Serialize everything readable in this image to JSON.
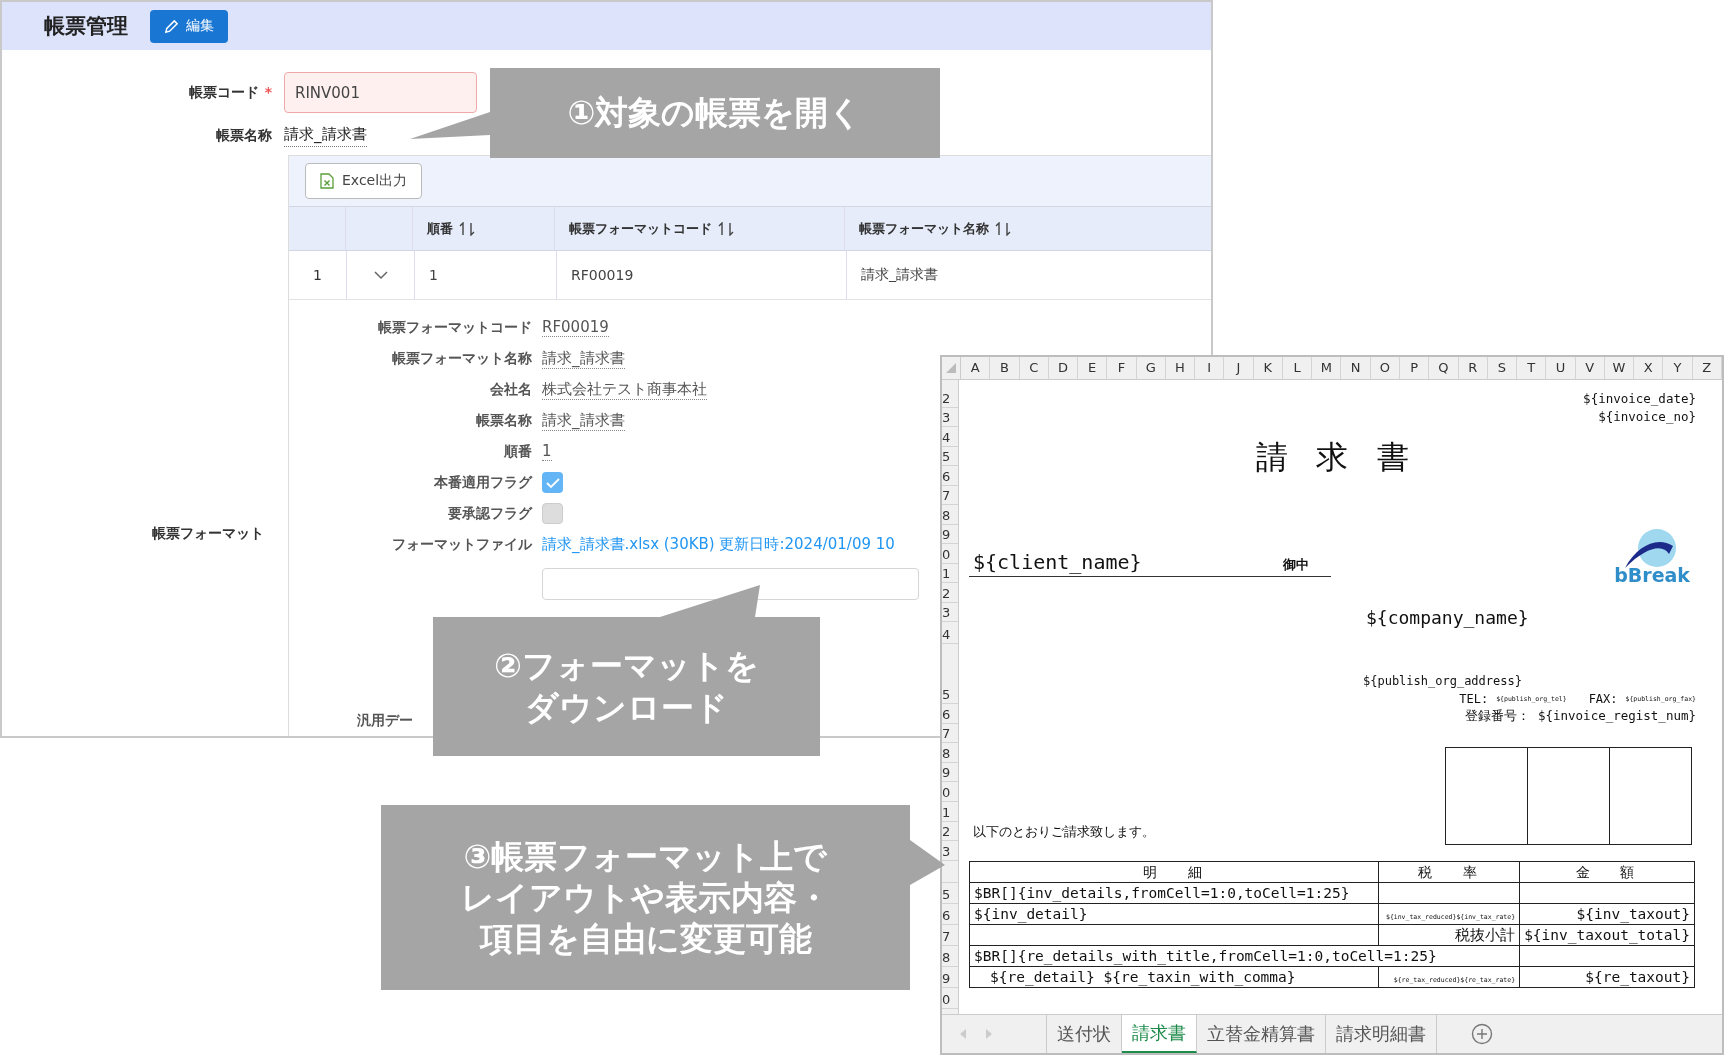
{
  "app": {
    "title": "帳票管理",
    "edit_button": "編集",
    "fields": [
      {
        "label": "帳票コード",
        "required_mark": "*",
        "value": "RINV001",
        "kind": "input"
      },
      {
        "label": "帳票名称",
        "value": "請求_請求書",
        "kind": "text"
      }
    ],
    "section_label": "帳票フォーマット",
    "excel_button": "Excel出力",
    "table": {
      "columns": [
        "",
        "",
        "順番",
        "帳票フォーマットコード",
        "帳票フォーマット名称"
      ],
      "rows": [
        {
          "cells": [
            "1",
            "",
            "1",
            "RF00019",
            "請求_請求書"
          ],
          "expanded": true
        }
      ]
    },
    "details": [
      {
        "label": "帳票フォーマットコード",
        "value": "RF00019",
        "kind": "text"
      },
      {
        "label": "帳票フォーマット名称",
        "value": "請求_請求書",
        "kind": "text"
      },
      {
        "label": "会社名",
        "value": "株式会社テスト商事本社",
        "kind": "text"
      },
      {
        "label": "帳票名称",
        "value": "請求_請求書",
        "kind": "text"
      },
      {
        "label": "順番",
        "value": "1",
        "kind": "text"
      },
      {
        "label": "本番適用フラグ",
        "checked": true,
        "kind": "checkbox"
      },
      {
        "label": "要承認フラグ",
        "checked": false,
        "kind": "checkbox"
      },
      {
        "label": "フォーマットファイル",
        "value": "請求_請求書.xlsx (30KB) 更新日時:2024/01/09 10",
        "kind": "link"
      }
    ],
    "generic_label": "汎用デー"
  },
  "excel": {
    "columns": [
      "A",
      "B",
      "C",
      "D",
      "E",
      "F",
      "G",
      "H",
      "I",
      "J",
      "K",
      "L",
      "M",
      "N",
      "O",
      "P",
      "Q",
      "R",
      "S",
      "T",
      "U",
      "V",
      "W",
      "X",
      "Y",
      "Z"
    ],
    "rows": [
      "2",
      "3",
      "4",
      "5",
      "6",
      "7",
      "8",
      "9",
      "0",
      "1",
      "2",
      "3",
      "4",
      "5",
      "6",
      "7",
      "8",
      "9",
      "0",
      "1",
      "2",
      "3",
      "5",
      "6",
      "7",
      "8",
      "9",
      "0"
    ],
    "invoice_date": "${invoice_date}",
    "invoice_no": "${invoice_no}",
    "title": "請求書",
    "client_name": "${client_name}",
    "honorific": "御中",
    "logo_text": "bBreak",
    "company_name": "${company_name}",
    "address": "${publish_org_address}",
    "tel_label": "TEL:",
    "tel": "${publish_org_tel}",
    "fax_label": "FAX:",
    "fax": "${publish_org_fax}",
    "regist": "登録番号： ${invoice_regist_num}",
    "greeting": "以下のとおりご請求致します。",
    "table": {
      "header": [
        "明細",
        "税率",
        "金額"
      ],
      "rows": [
        {
          "cells": [
            {
              "text": "$BR[]{inv_details,fromCell=1:0,toCell=1:25}"
            },
            {},
            {}
          ]
        },
        {
          "cells": [
            {
              "text": "${inv_detail}"
            },
            {
              "text": "${inv_tax_reduced}${inv_tax_rate}",
              "kind": "small"
            },
            {
              "text": "${inv_taxout}"
            }
          ]
        },
        {
          "cells": [
            {},
            {
              "text": "税抜小計"
            },
            {
              "text": "${inv_taxout_total}"
            }
          ]
        },
        {
          "cells": [
            {
              "text": "$BR[]{re_details_with_title,fromCell=1:0,toCell=1:25}",
              "colspan": 2
            },
            {}
          ]
        },
        {
          "cells": [
            {
              "text": "${re_detail}  ${re_taxin_with_comma}",
              "indent": true
            },
            {
              "text": "${re_tax_reduced}${re_tax_rate}",
              "kind": "small"
            },
            {
              "text": "${re_taxout}"
            }
          ]
        }
      ]
    },
    "tabs": [
      {
        "label": "送付状",
        "selected": false
      },
      {
        "label": "請求書",
        "selected": true
      },
      {
        "label": "立替金精算書",
        "selected": false
      },
      {
        "label": "請求明細書",
        "selected": false
      }
    ]
  },
  "callouts": [
    {
      "lines": [
        "①対象の帳票を開く"
      ]
    },
    {
      "lines": [
        "②フォーマットを",
        "ダウンロード"
      ]
    },
    {
      "lines": [
        "③帳票フォーマット上で",
        "レイアウトや表示内容・",
        "項目を自由に変更可能"
      ]
    }
  ]
}
